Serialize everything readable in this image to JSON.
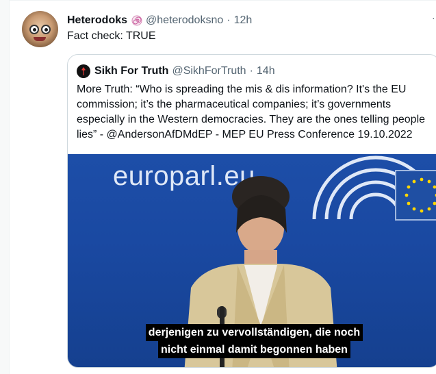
{
  "tweet": {
    "display_name": "Heterodoks",
    "badge_icon": "spiral-icon",
    "handle": "@heterodoksno",
    "separator": "·",
    "time": "12h",
    "text": "Fact check: TRUE"
  },
  "quoted_tweet": {
    "display_name": "Sikh For Truth",
    "handle": "@SikhForTruth",
    "separator": "·",
    "time": "14h",
    "text": "More Truth: “Who is spreading the mis & dis information? It's the EU commission; it’s the pharmaceutical companies; it’s governments especially in the Western democracies. They are the ones telling people lies” - @AndersonAfDMdEP - MEP EU Press Conference 19.10.2022",
    "media": {
      "backdrop_text": "europarl.eu",
      "captions": [
        "derjenigen zu vervollständigen, die noch",
        "nicht einmal damit begonnen haben"
      ]
    }
  },
  "colors": {
    "accent_text": "#0f1419",
    "muted_text": "#536471",
    "border": "#cfd9de",
    "media_blue": "#1d4ea8"
  }
}
